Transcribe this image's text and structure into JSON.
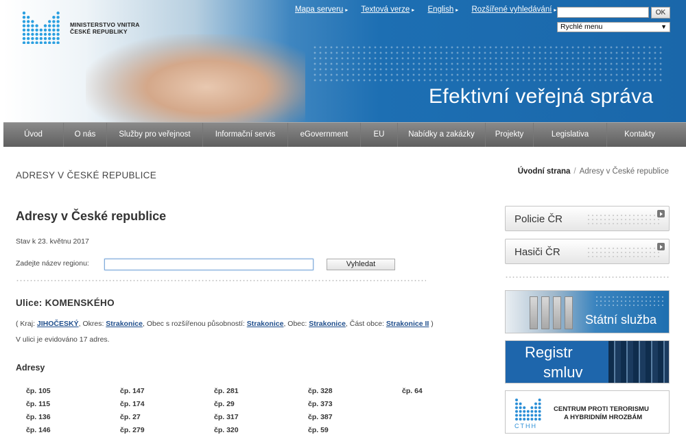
{
  "header": {
    "logo_text_line1": "MINISTERSTVO VNITRA",
    "logo_text_line2": "ČESKÉ REPUBLIKY",
    "slogan": "Efektivní veřejná správa",
    "top_links": [
      "Mapa serveru",
      "Textová verze",
      "English",
      "Rozšířené vyhledávání"
    ],
    "search_button": "OK",
    "quick_menu": "Rychlé menu"
  },
  "nav": {
    "items": [
      "Úvod",
      "O nás",
      "Služby pro veřejnost",
      "Informační servis",
      "eGovernment",
      "EU",
      "Nabídky a zakázky",
      "Projekty",
      "Legislativa",
      "Kontakty"
    ]
  },
  "section_title": "ADRESY V ČESKÉ REPUBLICE",
  "breadcrumb": {
    "home": "Úvodní strana",
    "separator": "/",
    "current": "Adresy v České republice"
  },
  "main": {
    "title": "Adresy v České republice",
    "stav": "Stav k 23. květnu 2017",
    "region_label": "Zadejte název regionu:",
    "region_value": "",
    "search_button": "Vyhledat",
    "street_label": "Ulice:",
    "street_name": "KOMENSKÉHO",
    "hierarchy": {
      "open": "( Kraj: ",
      "kraj": "JIHOČESKÝ",
      "okres_label": ", Okres: ",
      "okres": "Strakonice",
      "orp_label": ", Obec s rozšířenou působností: ",
      "orp": "Strakonice",
      "obec_label": ", Obec: ",
      "obec": "Strakonice",
      "cast_label": ", Část obce: ",
      "cast": "Strakonice II",
      "close": " )"
    },
    "count_text": "V ulici je evidováno 17 adres.",
    "addresses_heading": "Adresy",
    "addresses": [
      [
        "čp. 105",
        "čp. 115",
        "čp. 136",
        "čp. 146"
      ],
      [
        "čp. 147",
        "čp. 174",
        "čp. 27",
        "čp. 279"
      ],
      [
        "čp. 281",
        "čp. 29",
        "čp. 317",
        "čp. 320"
      ],
      [
        "čp. 328",
        "čp. 373",
        "čp. 387",
        "čp. 59"
      ],
      [
        "čp. 64"
      ]
    ]
  },
  "sidebar": {
    "policie": "Policie ČR",
    "hasici": "Hasiči ČR",
    "statni_sluzba": "Státní služba",
    "registr_line1": "Registr",
    "registr_line2": "smluv",
    "cthh_line1": "CENTRUM PROTI TERORISMU",
    "cthh_line2": "A HYBRIDNÍM HROZBÁM",
    "cthh_abbr": "CTHH"
  },
  "colors": {
    "header_blue": "#1d6fb3",
    "nav_gray": "#6f6f6f",
    "link_blue": "#1f4e8c",
    "logo_cyan": "#2a9fe0"
  }
}
